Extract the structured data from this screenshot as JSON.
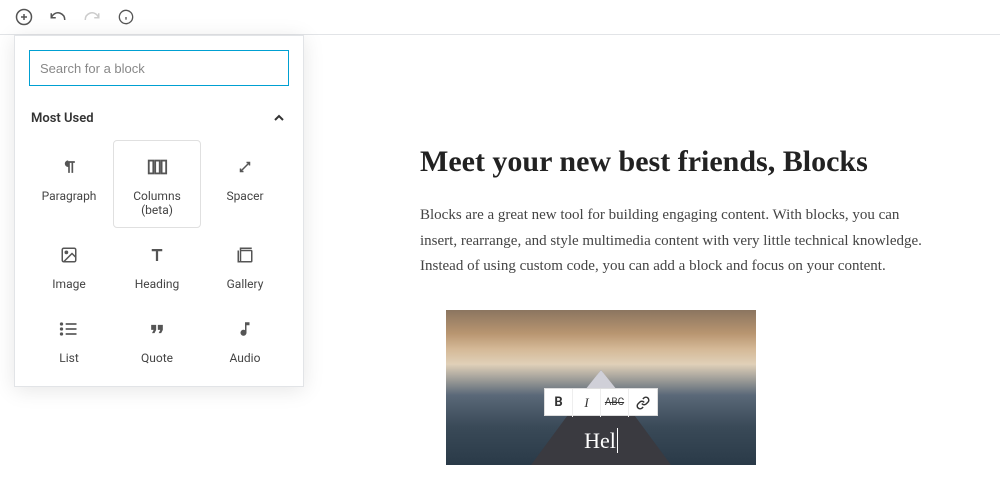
{
  "toolbar": {
    "add": "add-block",
    "undo": "undo",
    "redo": "redo",
    "info": "info"
  },
  "search": {
    "placeholder": "Search for a block"
  },
  "section": {
    "title": "Most Used"
  },
  "blocks": [
    {
      "label": "Paragraph",
      "icon": "paragraph-icon"
    },
    {
      "label": "Columns (beta)",
      "icon": "columns-icon"
    },
    {
      "label": "Spacer",
      "icon": "spacer-icon"
    },
    {
      "label": "Image",
      "icon": "image-icon"
    },
    {
      "label": "Heading",
      "icon": "heading-icon"
    },
    {
      "label": "Gallery",
      "icon": "gallery-icon"
    },
    {
      "label": "List",
      "icon": "list-icon"
    },
    {
      "label": "Quote",
      "icon": "quote-icon"
    },
    {
      "label": "Audio",
      "icon": "audio-icon"
    }
  ],
  "content": {
    "title": "Meet your new best friends, Blocks",
    "body": "Blocks are a great new tool for building engaging content. With blocks, you can insert, rearrange, and style multimedia content with very little technical knowledge. Instead of using custom code, you can add a block and focus on your content."
  },
  "format": {
    "bold": "B",
    "italic": "I",
    "strike": "ABC",
    "link": "link"
  },
  "cover": {
    "text": "Hel"
  }
}
